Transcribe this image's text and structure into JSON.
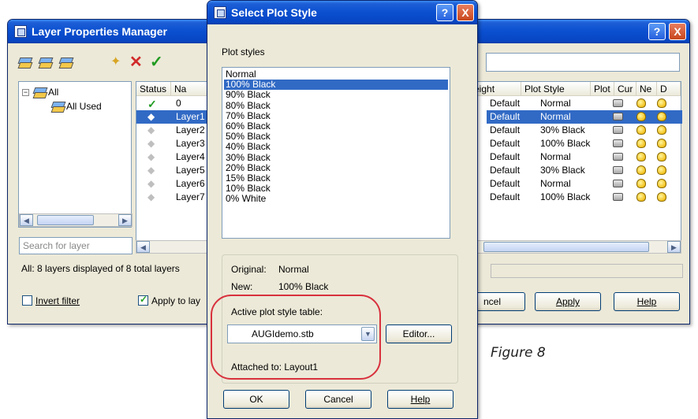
{
  "lpm": {
    "title": "Layer Properties Manager",
    "tree": {
      "root": "All",
      "child": "All Used"
    },
    "search_placeholder": "Search for layer",
    "columns": [
      "Status",
      "Na",
      "eight",
      "Plot Style",
      "Plot",
      "Cur",
      "Ne",
      "D"
    ],
    "rows": [
      {
        "status": "current",
        "name": "0",
        "lineweight": "Default",
        "plot_style": "Normal"
      },
      {
        "status": "selected",
        "name": "Layer1",
        "lineweight": "Default",
        "plot_style": "Normal"
      },
      {
        "status": "",
        "name": "Layer2",
        "lineweight": "Default",
        "plot_style": "30% Black"
      },
      {
        "status": "",
        "name": "Layer3",
        "lineweight": "Default",
        "plot_style": "100% Black"
      },
      {
        "status": "",
        "name": "Layer4",
        "lineweight": "Default",
        "plot_style": "Normal"
      },
      {
        "status": "",
        "name": "Layer5",
        "lineweight": "Default",
        "plot_style": "30% Black"
      },
      {
        "status": "",
        "name": "Layer6",
        "lineweight": "Default",
        "plot_style": "Normal"
      },
      {
        "status": "",
        "name": "Layer7",
        "lineweight": "Default",
        "plot_style": "100% Black"
      }
    ],
    "status_text": "All: 8 layers displayed of 8 total layers",
    "invert_filter": "Invert filter",
    "apply_to": "Apply to lay",
    "cancel_partial": "ncel",
    "apply": "Apply",
    "help": "Help",
    "help_glyph": "?",
    "close_glyph": "X"
  },
  "sps": {
    "title": "Select Plot Style",
    "plot_styles_label": "Plot styles",
    "styles": [
      "Normal",
      "100% Black",
      "90% Black",
      "80% Black",
      "70% Black",
      "60% Black",
      "50% Black",
      "40% Black",
      "30% Black",
      "20% Black",
      "15% Black",
      "10% Black",
      "0% White"
    ],
    "selected_index": 1,
    "original_label": "Original:",
    "original_value": "Normal",
    "new_label": "New:",
    "new_value": "100% Black",
    "active_table_label": "Active plot style table:",
    "active_table_value": "AUGIdemo.stb",
    "editor": "Editor...",
    "attached": "Attached to: Layout1",
    "ok": "OK",
    "cancel": "Cancel",
    "help": "Help"
  },
  "caption": "Figure 8",
  "colors": {
    "title_blue": "#0a4fd0",
    "selection": "#316ac5",
    "highlight_loop": "#d8313d"
  }
}
